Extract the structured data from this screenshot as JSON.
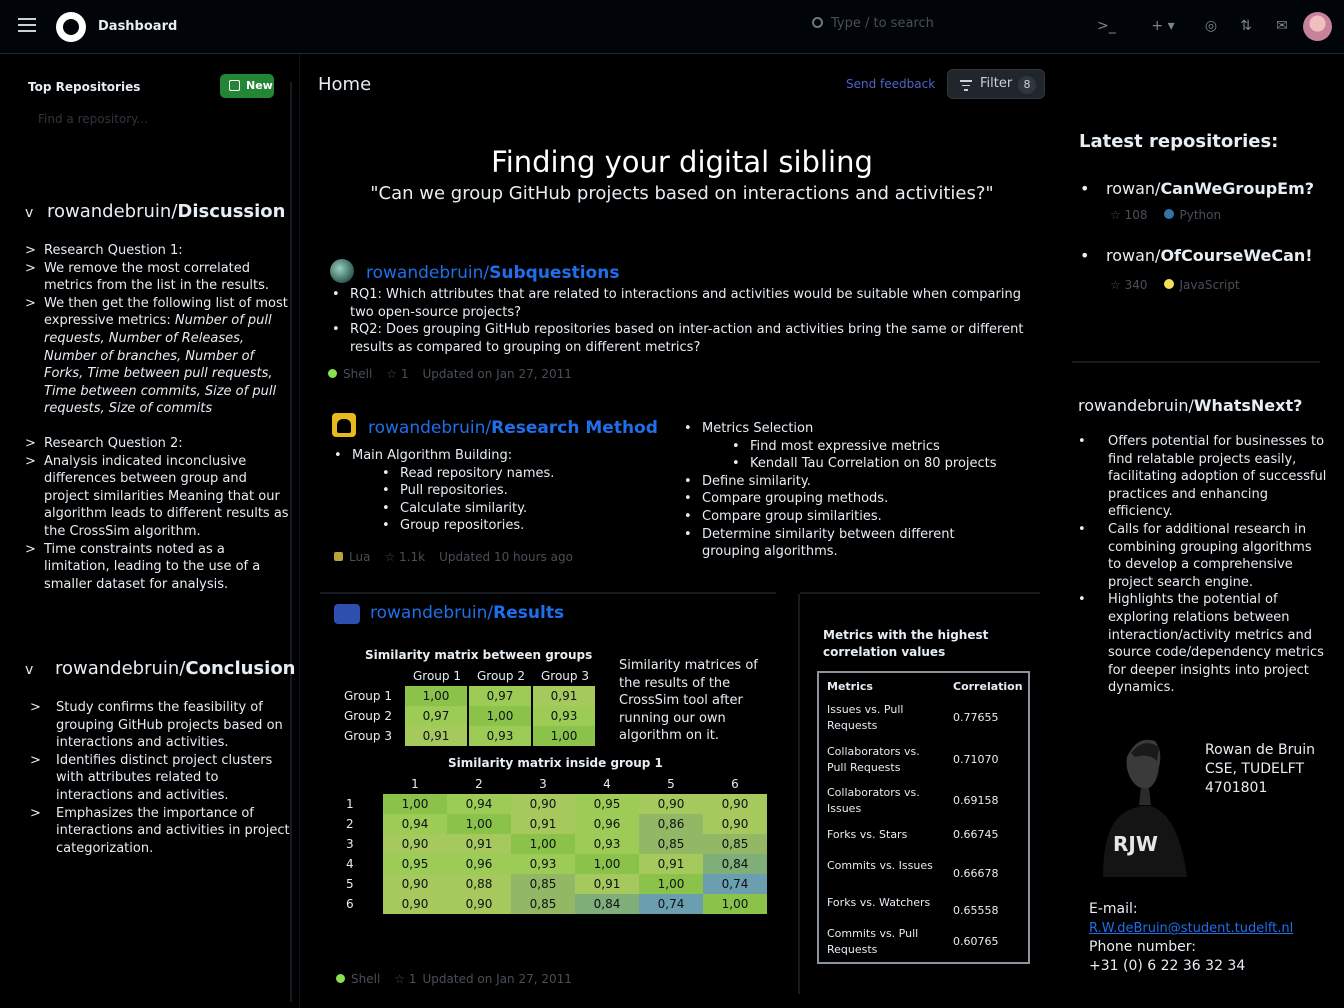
{
  "topbar": {
    "brand": "Dashboard",
    "search_placeholder": "Type / to search"
  },
  "sidebar": {
    "title": "Top Repositories",
    "new_label": "New",
    "find_placeholder": "Find a repository..."
  },
  "discussion": {
    "owner": "rowandebruin/",
    "name": "Discussion",
    "items": [
      "Research Question 1:",
      "We remove the most correlated metrics from the list in the results.",
      "We then get the following list of most expressive metrics: ",
      "Research Question 2:",
      "Analysis indicated inconclusive differences between group and project similarities Meaning that our algorithm leads to different results as the CrossSim algorithm.",
      "Time constraints noted as a limitation, leading to the use of a smaller dataset for analysis."
    ],
    "metrics_italic": "Number of pull requests, Number of Releases, Number of branches, Number of Forks, Time between pull requests, Time between commits, Size of pull requests, Size of commits"
  },
  "conclusion": {
    "owner": "rowandebruin/",
    "name": "Conclusion",
    "items": [
      "Study confirms the feasibility of grouping GitHub projects based on interactions and activities.",
      "Identifies distinct project clusters with attributes related to interactions and activities.",
      "Emphasizes the importance of interactions and activities in project categorization."
    ]
  },
  "main": {
    "title": "Home",
    "send_feedback": "Send feedback",
    "filter_label": "Filter",
    "filter_count": "8",
    "headline": "Finding your digital sibling",
    "subline": "\"Can we group GitHub projects based on interactions and activities?\""
  },
  "subquestions": {
    "owner": "rowandebruin/",
    "name": "Subquestions",
    "items": [
      "RQ1: Which attributes that are related to interactions and activities would be suitable when comparing two open-source projects?",
      "RQ2: Does grouping GitHub repositories based on inter-action and activities bring the same or different results as compared to grouping on different metrics?"
    ],
    "lang": "Shell",
    "stars": "1",
    "updated": "Updated on Jan 27, 2011"
  },
  "method": {
    "owner": "rowandebruin/",
    "name": "Research Method",
    "main_item": "Main Algorithm Building:",
    "sub_items": [
      "Read repository names.",
      "Pull repositories.",
      "Calculate similarity.",
      "Group repositories."
    ],
    "right_items": [
      {
        "text": "Metrics Selection",
        "sub": [
          "Find most expressive metrics",
          "Kendall Tau Correlation on 80 projects"
        ]
      },
      {
        "text": "Define similarity.",
        "sub": []
      },
      {
        "text": "Compare grouping methods.",
        "sub": []
      },
      {
        "text": "Compare group similarities.",
        "sub": []
      },
      {
        "text": "Determine similarity between different grouping algorithms.",
        "sub": []
      }
    ],
    "lang": "Lua",
    "stars": "1.1k",
    "updated": "Updated 10 hours ago"
  },
  "results": {
    "owner": "rowandebruin/",
    "name": "Results",
    "groups_caption": "Similarity matrix between groups",
    "groups_headers": [
      "Group 1",
      "Group 2",
      "Group 3"
    ],
    "groups_rows": [
      {
        "label": "Group 1",
        "values": [
          "1,00",
          "0,97",
          "0,91"
        ]
      },
      {
        "label": "Group 2",
        "values": [
          "0,97",
          "1,00",
          "0,93"
        ]
      },
      {
        "label": "Group 3",
        "values": [
          "0,91",
          "0,93",
          "1,00"
        ]
      }
    ],
    "inside_caption": "Similarity matrix inside group 1",
    "inside_headers": [
      "1",
      "2",
      "3",
      "4",
      "5",
      "6"
    ],
    "inside_rows": [
      {
        "label": "1",
        "values": [
          "1,00",
          "0,94",
          "0,90",
          "0,95",
          "0,90",
          "0,90"
        ]
      },
      {
        "label": "2",
        "values": [
          "0,94",
          "1,00",
          "0,91",
          "0,96",
          "0,86",
          "0,90"
        ]
      },
      {
        "label": "3",
        "values": [
          "0,90",
          "0,91",
          "1,00",
          "0,93",
          "0,85",
          "0,85"
        ]
      },
      {
        "label": "4",
        "values": [
          "0,95",
          "0,96",
          "0,93",
          "1,00",
          "0,91",
          "0,84"
        ]
      },
      {
        "label": "5",
        "values": [
          "0,90",
          "0,88",
          "0,85",
          "0,91",
          "1,00",
          "0,74"
        ]
      },
      {
        "label": "6",
        "values": [
          "0,90",
          "0,90",
          "0,85",
          "0,84",
          "0,74",
          "1,00"
        ]
      }
    ],
    "note": "Similarity matrices of the results of the CrossSim tool after running our own algorithm on it.",
    "lang": "Shell",
    "stars": "1",
    "updated": "Updated on Jan 27, 2011"
  },
  "correlation": {
    "title": "Metrics with the highest correlation values",
    "col_metric": "Metrics",
    "col_corr": "Correlation",
    "rows": [
      {
        "metric": "Issues vs. Pull Requests",
        "value": "0.77655"
      },
      {
        "metric": "Collaborators vs. Pull Requests",
        "value": "0.71070"
      },
      {
        "metric": "Collaborators vs. Issues",
        "value": "0.69158"
      },
      {
        "metric": "Forks vs. Stars",
        "value": "0.66745"
      },
      {
        "metric": "Commits vs. Issues",
        "value": "0.66678"
      },
      {
        "metric": "Forks vs. Watchers",
        "value": "0.65558"
      },
      {
        "metric": "Commits vs. Pull Requests",
        "value": "0.60765"
      }
    ]
  },
  "latest": {
    "title": "Latest repositories:",
    "repos": [
      {
        "owner": "rowan/",
        "name": "CanWeGroupEm?",
        "stars": "108",
        "lang": "Python",
        "color": "#3572A5"
      },
      {
        "owner": "rowan/",
        "name": "OfCourseWeCan!",
        "stars": "340",
        "lang": "JavaScript",
        "color": "#f1e05a"
      }
    ]
  },
  "whatsnext": {
    "owner": "rowandebruin/",
    "name": "WhatsNext?",
    "items": [
      "Offers potential for businesses to find relatable projects easily, facilitating adoption of successful practices and enhancing efficiency.",
      "Calls for additional research in combining grouping algorithms to develop a comprehensive project search engine.",
      "Highlights the potential of exploring relations between interaction/activity metrics and source code/dependency metrics for deeper insights into project dynamics."
    ]
  },
  "profile": {
    "name": "Rowan de Bruin",
    "dept": "CSE, TUDELFT",
    "id": "4701801",
    "shirt_text": "RJW",
    "email_label": "E-mail:",
    "email": "R.W.deBruin@student.tudelft.nl",
    "phone_label": "Phone number:",
    "phone": "+31 (0) 6 22 36 32 34"
  },
  "colors": {
    "accent": "#1f6feb",
    "new_button": "#238636",
    "cell_high": "#8bc34a",
    "cell_mid": "#a6c95e",
    "cell_low": "#6b9f8f"
  }
}
